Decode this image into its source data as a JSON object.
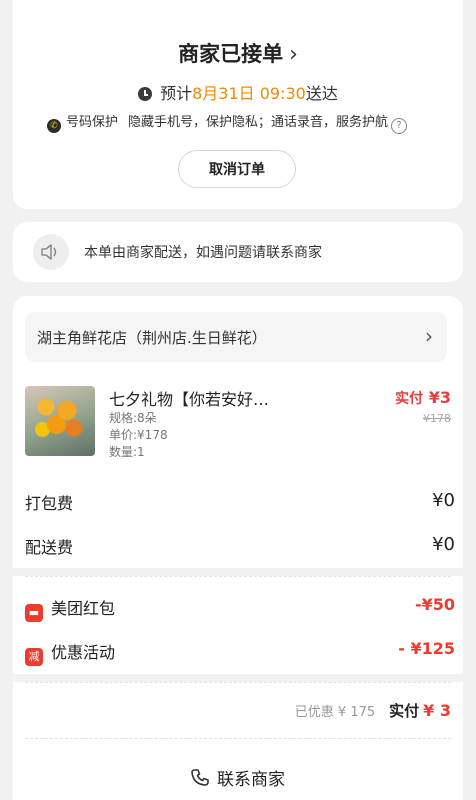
{
  "status": {
    "title": "商家已接单",
    "eta_prefix": "预计",
    "eta_time": "8月31日 09:30",
    "eta_suffix": "送达",
    "protect_label": "号码保护",
    "protect_desc": "隐藏手机号，保护隐私；通话录音，服务护航",
    "cancel_label": "取消订单"
  },
  "notice": {
    "text": "本单由商家配送，如遇问题请联系商家"
  },
  "shop": {
    "name": "湖主角鲜花店（荆州店.生日鲜花）"
  },
  "product": {
    "title": "七夕礼物【你若安好…",
    "spec": "规格:8朵",
    "unit_price": "单价:¥178",
    "quantity": "数量:1",
    "paid_label": "实付",
    "paid_amount": "¥3",
    "original_price": "¥178"
  },
  "fees": [
    {
      "label": "打包费",
      "value": "¥0"
    },
    {
      "label": "配送费",
      "value": "¥0"
    }
  ],
  "discounts": [
    {
      "icon": "red-packet-icon",
      "label": "美团红包",
      "value": "-¥50"
    },
    {
      "icon": "discount-icon",
      "icon_text": "减",
      "label": "优惠活动",
      "value": "- ¥125"
    }
  ],
  "summary": {
    "saved": "已优惠 ¥ 175",
    "paid_label": "实付",
    "paid_amount": "¥ 3"
  },
  "contact": {
    "label": "联系商家"
  },
  "colors": {
    "accent_orange": "#f08a00",
    "discount_red": "#ef3b2d"
  }
}
